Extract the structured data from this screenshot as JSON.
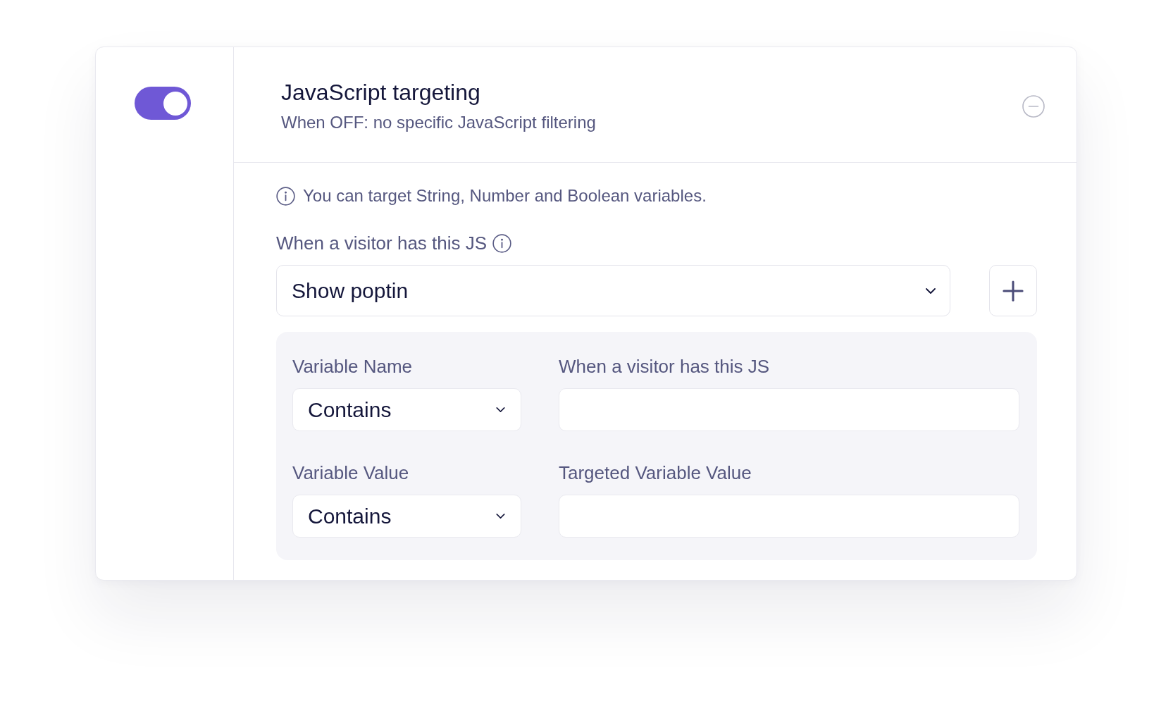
{
  "toggle": {
    "on": true
  },
  "header": {
    "title": "JavaScript targeting",
    "subtitle": "When OFF: no specific JavaScript filtering"
  },
  "info_note": "You can target String, Number and Boolean variables.",
  "js_select": {
    "label": "When a visitor has this JS",
    "value": "Show poptin"
  },
  "conditions": [
    {
      "label": "Variable Name",
      "operator": "Contains",
      "input_label": "When a visitor has this JS"
    },
    {
      "label": "Variable Value",
      "operator": "Contains",
      "input_label": "Targeted Variable Value"
    }
  ]
}
